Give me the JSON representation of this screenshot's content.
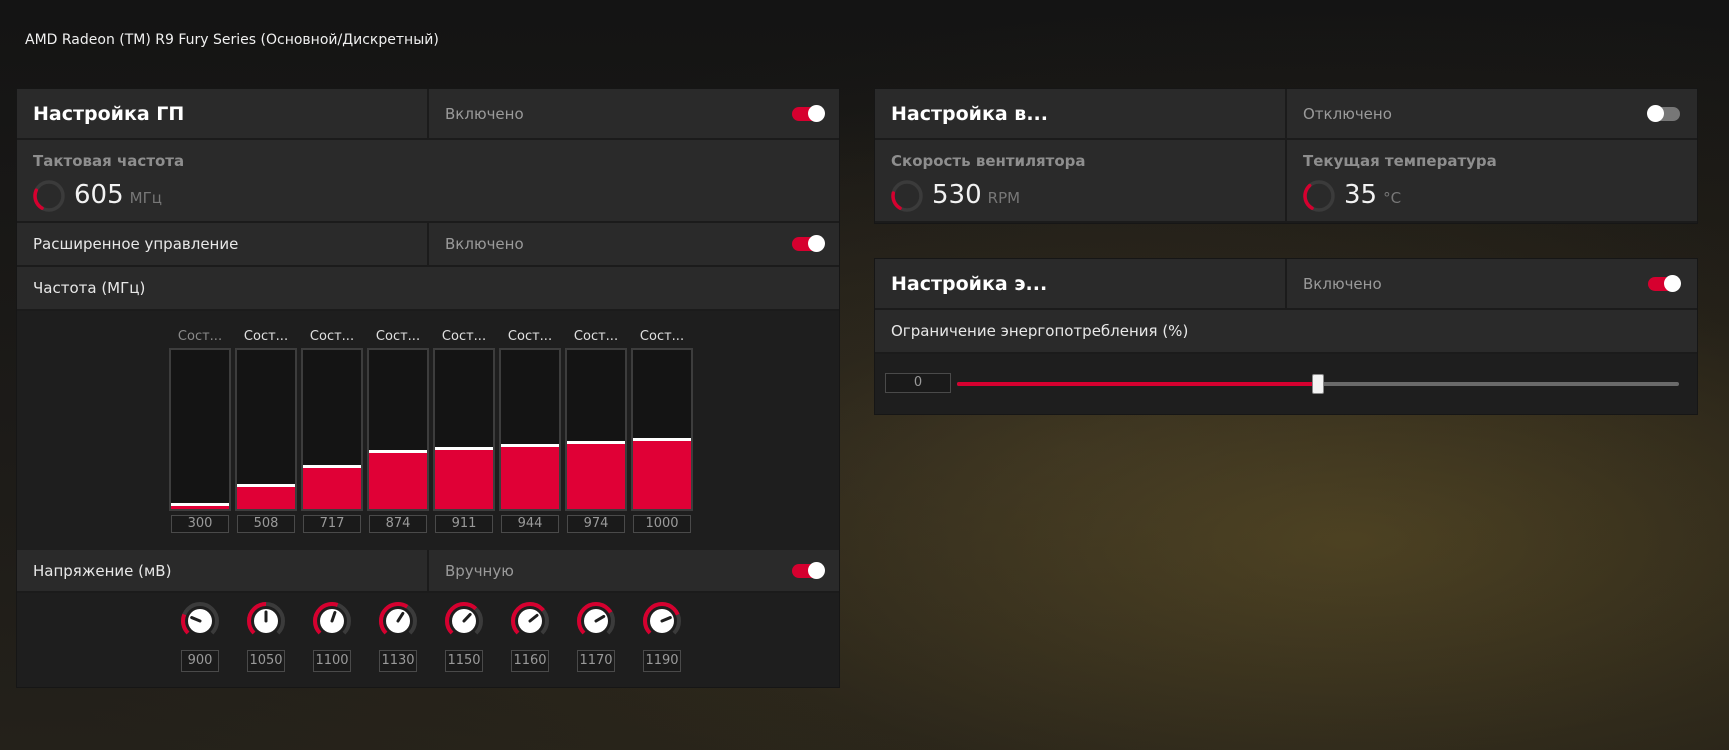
{
  "device_title": "AMD Radeon (TM) R9 Fury Series (Основной/Дискретный)",
  "colors": {
    "accent": "#d6002f",
    "panel": "#2a2a2a",
    "bg": "#1e1e1e"
  },
  "gpu": {
    "title": "Настройка ГП",
    "status": "Включено",
    "enabled": true,
    "clock": {
      "label": "Тактовая частота",
      "value": "605",
      "unit": "МГц",
      "gauge_fraction": 0.35
    },
    "advanced": {
      "label": "Расширенное управление",
      "status": "Включено",
      "enabled": true
    },
    "freq_header": "Частота (МГц)",
    "states": [
      {
        "label": "Сост...",
        "value": "300",
        "fill_fraction": 0.02,
        "dim": true
      },
      {
        "label": "Сост...",
        "value": "508",
        "fill_fraction": 0.14
      },
      {
        "label": "Сост...",
        "value": "717",
        "fill_fraction": 0.26
      },
      {
        "label": "Сост...",
        "value": "874",
        "fill_fraction": 0.35
      },
      {
        "label": "Сост...",
        "value": "911",
        "fill_fraction": 0.37
      },
      {
        "label": "Сост...",
        "value": "944",
        "fill_fraction": 0.39
      },
      {
        "label": "Сост...",
        "value": "974",
        "fill_fraction": 0.41
      },
      {
        "label": "Сост...",
        "value": "1000",
        "fill_fraction": 0.43
      }
    ],
    "voltage": {
      "label": "Напряжение (мВ)",
      "status": "Вручную",
      "enabled": true,
      "values": [
        {
          "value": "900",
          "level": 0.25
        },
        {
          "value": "1050",
          "level": 0.5
        },
        {
          "value": "1100",
          "level": 0.57
        },
        {
          "value": "1130",
          "level": 0.62
        },
        {
          "value": "1150",
          "level": 0.66
        },
        {
          "value": "1160",
          "level": 0.69
        },
        {
          "value": "1170",
          "level": 0.72
        },
        {
          "value": "1190",
          "level": 0.75
        }
      ]
    }
  },
  "fan": {
    "title": "Настройка в...",
    "status": "Отключено",
    "enabled": false,
    "speed": {
      "label": "Скорость вентилятора",
      "value": "530",
      "unit": "RPM",
      "gauge_fraction": 0.3
    },
    "temp": {
      "label": "Текущая температура",
      "value": "35",
      "unit": "°C",
      "gauge_fraction": 0.45
    }
  },
  "power": {
    "title": "Настройка э...",
    "status": "Включено",
    "enabled": true,
    "limit_label": "Ограничение энергопотребления (%)",
    "limit_value": "0",
    "slider_fraction": 0.5
  }
}
